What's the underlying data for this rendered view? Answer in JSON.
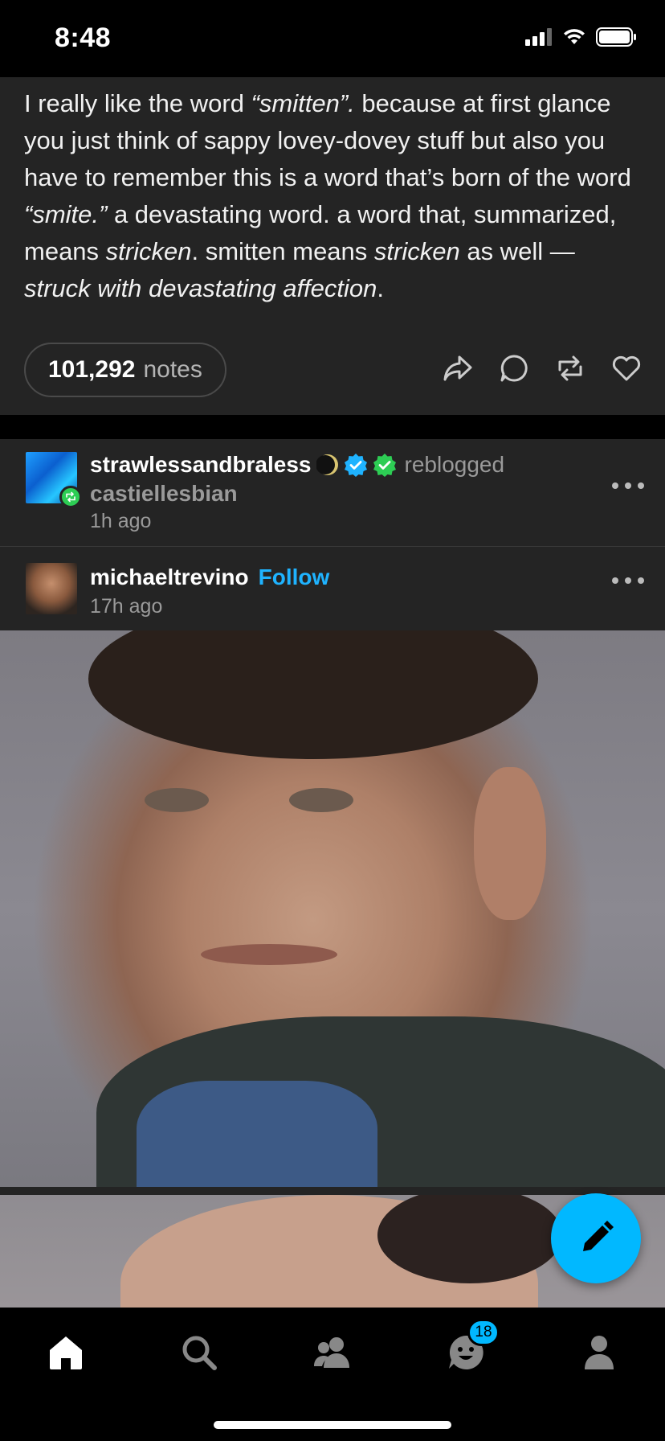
{
  "status_bar": {
    "time": "8:48"
  },
  "post1": {
    "segments": [
      {
        "text": "I really like the word ",
        "italic": false
      },
      {
        "text": "“smitten”.",
        "italic": true
      },
      {
        "text": " because at first glance you just think of sappy lovey-dovey stuff but also you have to remember this is a word that’s born of the word ",
        "italic": false
      },
      {
        "text": "“smite.”",
        "italic": true
      },
      {
        "text": " a devastating word. a word that, summarized, means ",
        "italic": false
      },
      {
        "text": "stricken",
        "italic": true
      },
      {
        "text": ". smitten means ",
        "italic": false
      },
      {
        "text": "stricken",
        "italic": true
      },
      {
        "text": " as well — ",
        "italic": false
      },
      {
        "text": "struck with devastating affection",
        "italic": true
      },
      {
        "text": ".",
        "italic": false
      }
    ],
    "notes_count": "101,292",
    "notes_label": "notes"
  },
  "post2": {
    "reblogger": "strawlessandbraless",
    "reblogged_label": "reblogged",
    "reblog_source": "castiellesbian",
    "reblog_time": "1h ago",
    "author": "michaeltrevino",
    "follow_label": "Follow",
    "author_time": "17h ago"
  },
  "tab_bar": {
    "activity_badge": "18"
  },
  "colors": {
    "accent": "#01b8ff",
    "background": "#242424",
    "verified": "#1fb3ff",
    "green_badge": "#2dcd54"
  }
}
